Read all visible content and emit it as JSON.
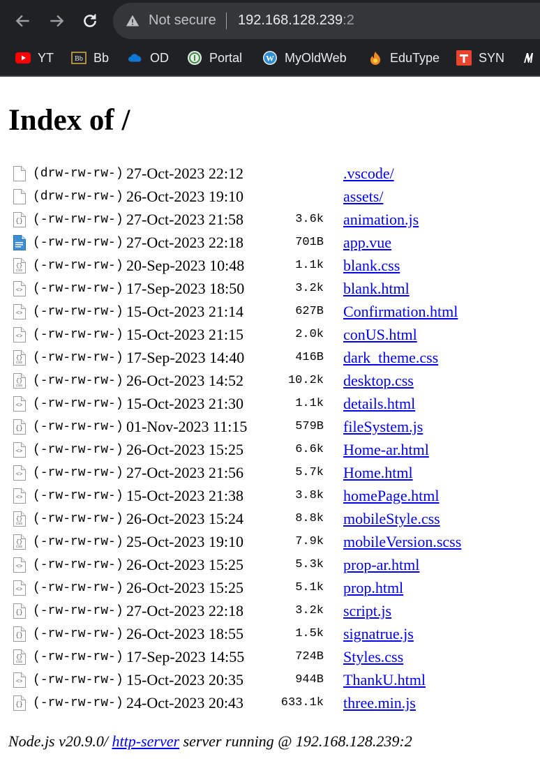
{
  "browser": {
    "security_label": "Not secure",
    "url_host": "192.168.128.239",
    "url_port": ":2",
    "bookmarks": [
      {
        "label": "YT",
        "icon": "youtube-icon",
        "color": "#ff0000"
      },
      {
        "label": "Bb",
        "icon": "blackboard-icon",
        "color": "#d9b44a"
      },
      {
        "label": "OD",
        "icon": "onedrive-icon",
        "color": "#0f78d4"
      },
      {
        "label": "Portal",
        "icon": "portal-seal-icon",
        "color": "#3a8f3a"
      },
      {
        "label": "MyOldWeb",
        "icon": "wordpress-icon",
        "color": "#2f8fd1"
      },
      {
        "label": "EduType",
        "icon": "edutype-flame-icon",
        "color": "#f08a24"
      },
      {
        "label": "SYN",
        "icon": "syn-icon",
        "color": "#e8442e"
      },
      {
        "label": "",
        "icon": "m-logo-icon",
        "color": "#ffffff"
      }
    ]
  },
  "page": {
    "title": "Index of /",
    "entries": [
      {
        "perm": "(drw-rw-rw-)",
        "date": "27-Oct-2023 22:12",
        "size": "",
        "name": ".vscode/",
        "icon": "folder-icon"
      },
      {
        "perm": "(drw-rw-rw-)",
        "date": "26-Oct-2023 19:10",
        "size": "",
        "name": "assets/",
        "icon": "folder-icon"
      },
      {
        "perm": "(-rw-rw-rw-)",
        "date": "27-Oct-2023 21:58",
        "size": "3.6k",
        "name": "animation.js",
        "icon": "js-file-icon"
      },
      {
        "perm": "(-rw-rw-rw-)",
        "date": "27-Oct-2023 22:18",
        "size": "701B",
        "name": "app.vue",
        "icon": "text-file-icon"
      },
      {
        "perm": "(-rw-rw-rw-)",
        "date": "20-Sep-2023 10:48",
        "size": "1.1k",
        "name": "blank.css",
        "icon": "css-file-icon"
      },
      {
        "perm": "(-rw-rw-rw-)",
        "date": "17-Sep-2023 18:50",
        "size": "3.2k",
        "name": "blank.html",
        "icon": "html-file-icon"
      },
      {
        "perm": "(-rw-rw-rw-)",
        "date": "15-Oct-2023 21:14",
        "size": "627B",
        "name": "Confirmation.html",
        "icon": "html-file-icon"
      },
      {
        "perm": "(-rw-rw-rw-)",
        "date": "15-Oct-2023 21:15",
        "size": "2.0k",
        "name": "conUS.html",
        "icon": "html-file-icon"
      },
      {
        "perm": "(-rw-rw-rw-)",
        "date": "17-Sep-2023 14:40",
        "size": "416B",
        "name": "dark_theme.css",
        "icon": "css-file-icon"
      },
      {
        "perm": "(-rw-rw-rw-)",
        "date": "26-Oct-2023 14:52",
        "size": "10.2k",
        "name": "desktop.css",
        "icon": "css-file-icon"
      },
      {
        "perm": "(-rw-rw-rw-)",
        "date": "15-Oct-2023 21:30",
        "size": "1.1k",
        "name": "details.html",
        "icon": "html-file-icon"
      },
      {
        "perm": "(-rw-rw-rw-)",
        "date": "01-Nov-2023 11:15",
        "size": "579B",
        "name": "fileSystem.js",
        "icon": "js-file-icon"
      },
      {
        "perm": "(-rw-rw-rw-)",
        "date": "26-Oct-2023 15:25",
        "size": "6.6k",
        "name": "Home-ar.html",
        "icon": "html-file-icon"
      },
      {
        "perm": "(-rw-rw-rw-)",
        "date": "27-Oct-2023 21:56",
        "size": "5.7k",
        "name": "Home.html",
        "icon": "html-file-icon"
      },
      {
        "perm": "(-rw-rw-rw-)",
        "date": "15-Oct-2023 21:38",
        "size": "3.8k",
        "name": "homePage.html",
        "icon": "html-file-icon"
      },
      {
        "perm": "(-rw-rw-rw-)",
        "date": "26-Oct-2023 15:24",
        "size": "8.8k",
        "name": "mobileStyle.css",
        "icon": "css-file-icon"
      },
      {
        "perm": "(-rw-rw-rw-)",
        "date": "25-Oct-2023 19:10",
        "size": "7.9k",
        "name": "mobileVersion.scss",
        "icon": "css-file-icon"
      },
      {
        "perm": "(-rw-rw-rw-)",
        "date": "26-Oct-2023 15:25",
        "size": "5.3k",
        "name": "prop-ar.html",
        "icon": "html-file-icon"
      },
      {
        "perm": "(-rw-rw-rw-)",
        "date": "26-Oct-2023 15:25",
        "size": "5.1k",
        "name": "prop.html",
        "icon": "html-file-icon"
      },
      {
        "perm": "(-rw-rw-rw-)",
        "date": "27-Oct-2023 22:18",
        "size": "3.2k",
        "name": "script.js",
        "icon": "js-file-icon"
      },
      {
        "perm": "(-rw-rw-rw-)",
        "date": "26-Oct-2023 18:55",
        "size": "1.5k",
        "name": "signatrue.js",
        "icon": "js-file-icon"
      },
      {
        "perm": "(-rw-rw-rw-)",
        "date": "17-Sep-2023 14:55",
        "size": "724B",
        "name": "Styles.css",
        "icon": "css-file-icon"
      },
      {
        "perm": "(-rw-rw-rw-)",
        "date": "15-Oct-2023 20:35",
        "size": "944B",
        "name": "ThankU.html",
        "icon": "html-file-icon"
      },
      {
        "perm": "(-rw-rw-rw-)",
        "date": "24-Oct-2023 20:43",
        "size": "633.1k",
        "name": "three.min.js",
        "icon": "js-file-icon"
      }
    ],
    "footer": {
      "prefix": "Node.js v20.9.0/ ",
      "link": "http-server",
      "suffix": " server running @ 192.168.128.239:2"
    }
  }
}
